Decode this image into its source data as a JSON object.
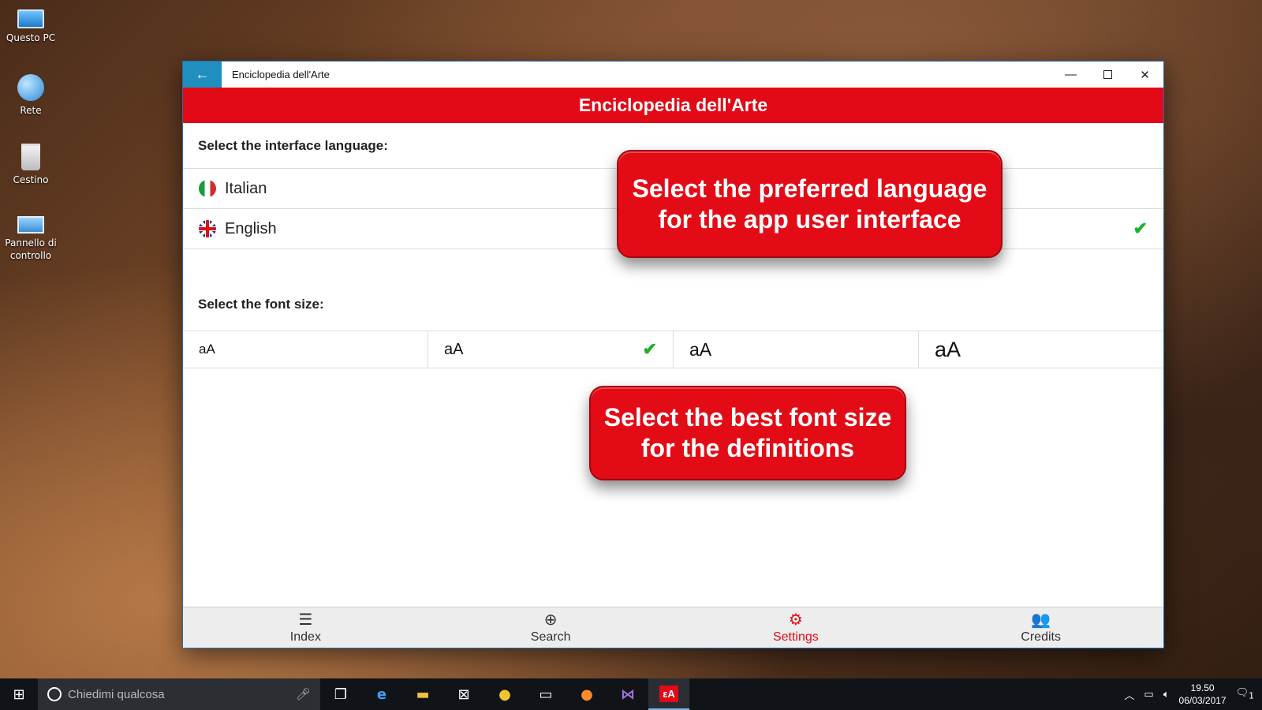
{
  "desktop": {
    "icons": [
      {
        "label": "Questo PC",
        "icon": "computer-icon"
      },
      {
        "label": "Rete",
        "icon": "network-icon"
      },
      {
        "label": "Cestino",
        "icon": "recycle-bin-icon"
      },
      {
        "label": "Pannello di controllo",
        "icon": "control-panel-icon"
      }
    ]
  },
  "window": {
    "title": "Enciclopedia dell'Arte",
    "controls": {
      "back": "←",
      "minimize": "—",
      "maximize": "",
      "close": "✕"
    }
  },
  "app": {
    "header": "Enciclopedia dell'Arte",
    "language": {
      "title": "Select the interface language:",
      "options": [
        {
          "label": "Italian",
          "flag": "italy-flag-icon",
          "selected": false
        },
        {
          "label": "English",
          "flag": "uk-flag-icon",
          "selected": true
        }
      ]
    },
    "font_size": {
      "title": "Select the font size:",
      "options": [
        {
          "label": "aA",
          "selected": false
        },
        {
          "label": "aA",
          "selected": true
        },
        {
          "label": "aA",
          "selected": false
        },
        {
          "label": "aA",
          "selected": false
        }
      ]
    },
    "check_glyph": "✔",
    "callouts": {
      "language": "Select the preferred language for the app user interface",
      "font": "Select the best font size for the definitions"
    },
    "nav": [
      {
        "label": "Index",
        "icon": "list-icon",
        "glyph": "☰",
        "active": false
      },
      {
        "label": "Search",
        "icon": "zoom-in-icon",
        "glyph": "⊕",
        "active": false
      },
      {
        "label": "Settings",
        "icon": "gear-icon",
        "glyph": "⚙",
        "active": true
      },
      {
        "label": "Credits",
        "icon": "users-icon",
        "glyph": "👥",
        "active": false
      }
    ],
    "accent": "#e20a16",
    "check_color": "#1cb02c"
  },
  "taskbar": {
    "search_placeholder": "Chiedimi qualcosa",
    "clock": {
      "time": "19.50",
      "date": "06/03/2017"
    },
    "notification_count": "1"
  }
}
